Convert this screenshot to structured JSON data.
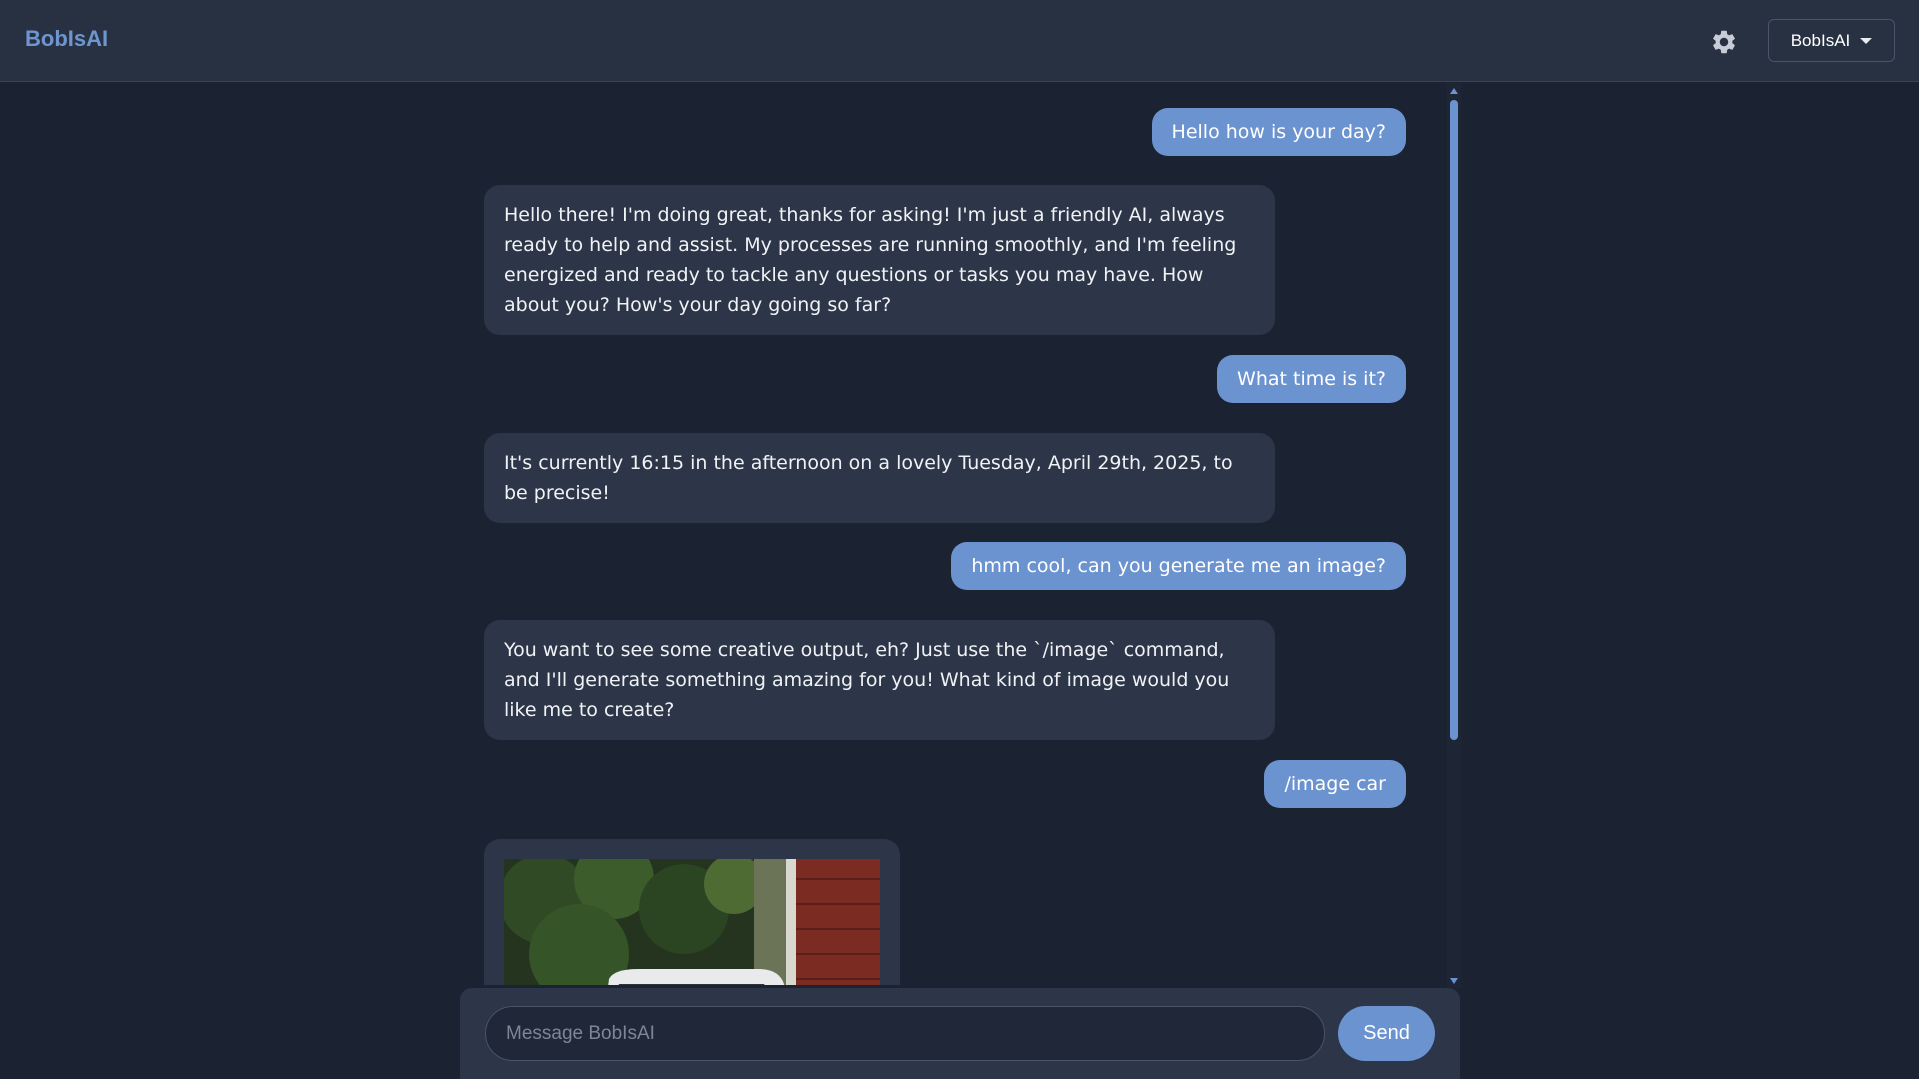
{
  "header": {
    "brand": "BobIsAI",
    "settings_icon": "gear-icon",
    "model_selector": "BobIsAI",
    "model_icon": "chevron-down-icon"
  },
  "messages": [
    {
      "role": "user",
      "text": "Hello how is your day?"
    },
    {
      "role": "assistant",
      "text": "Hello there! I'm doing great, thanks for asking! I'm just a friendly AI, always ready to help and assist. My processes are running smoothly, and I'm feeling energized and ready to tackle any questions or tasks you may have. How about you? How's your day going so far?"
    },
    {
      "role": "user",
      "text": "What time is it?"
    },
    {
      "role": "assistant",
      "text": "It's currently 16:15 in the afternoon on a lovely Tuesday, April 29th, 2025, to be precise!"
    },
    {
      "role": "user",
      "text": "hmm cool, can you generate me an image?"
    },
    {
      "role": "assistant",
      "text": "You want to see some creative output, eh? Just use the `/image` command, and I'll generate something amazing for you! What kind of image would you like me to create?"
    },
    {
      "role": "user",
      "text": "/image car"
    },
    {
      "role": "assistant",
      "type": "image",
      "image_subject": "generated-car-image"
    }
  ],
  "composer": {
    "placeholder": "Message BobIsAI",
    "value": "",
    "send_label": "Send"
  },
  "colors": {
    "accent": "#6b93d0",
    "background": "#1b2333",
    "header": "#283142",
    "bot_bubble": "#2d3648"
  }
}
